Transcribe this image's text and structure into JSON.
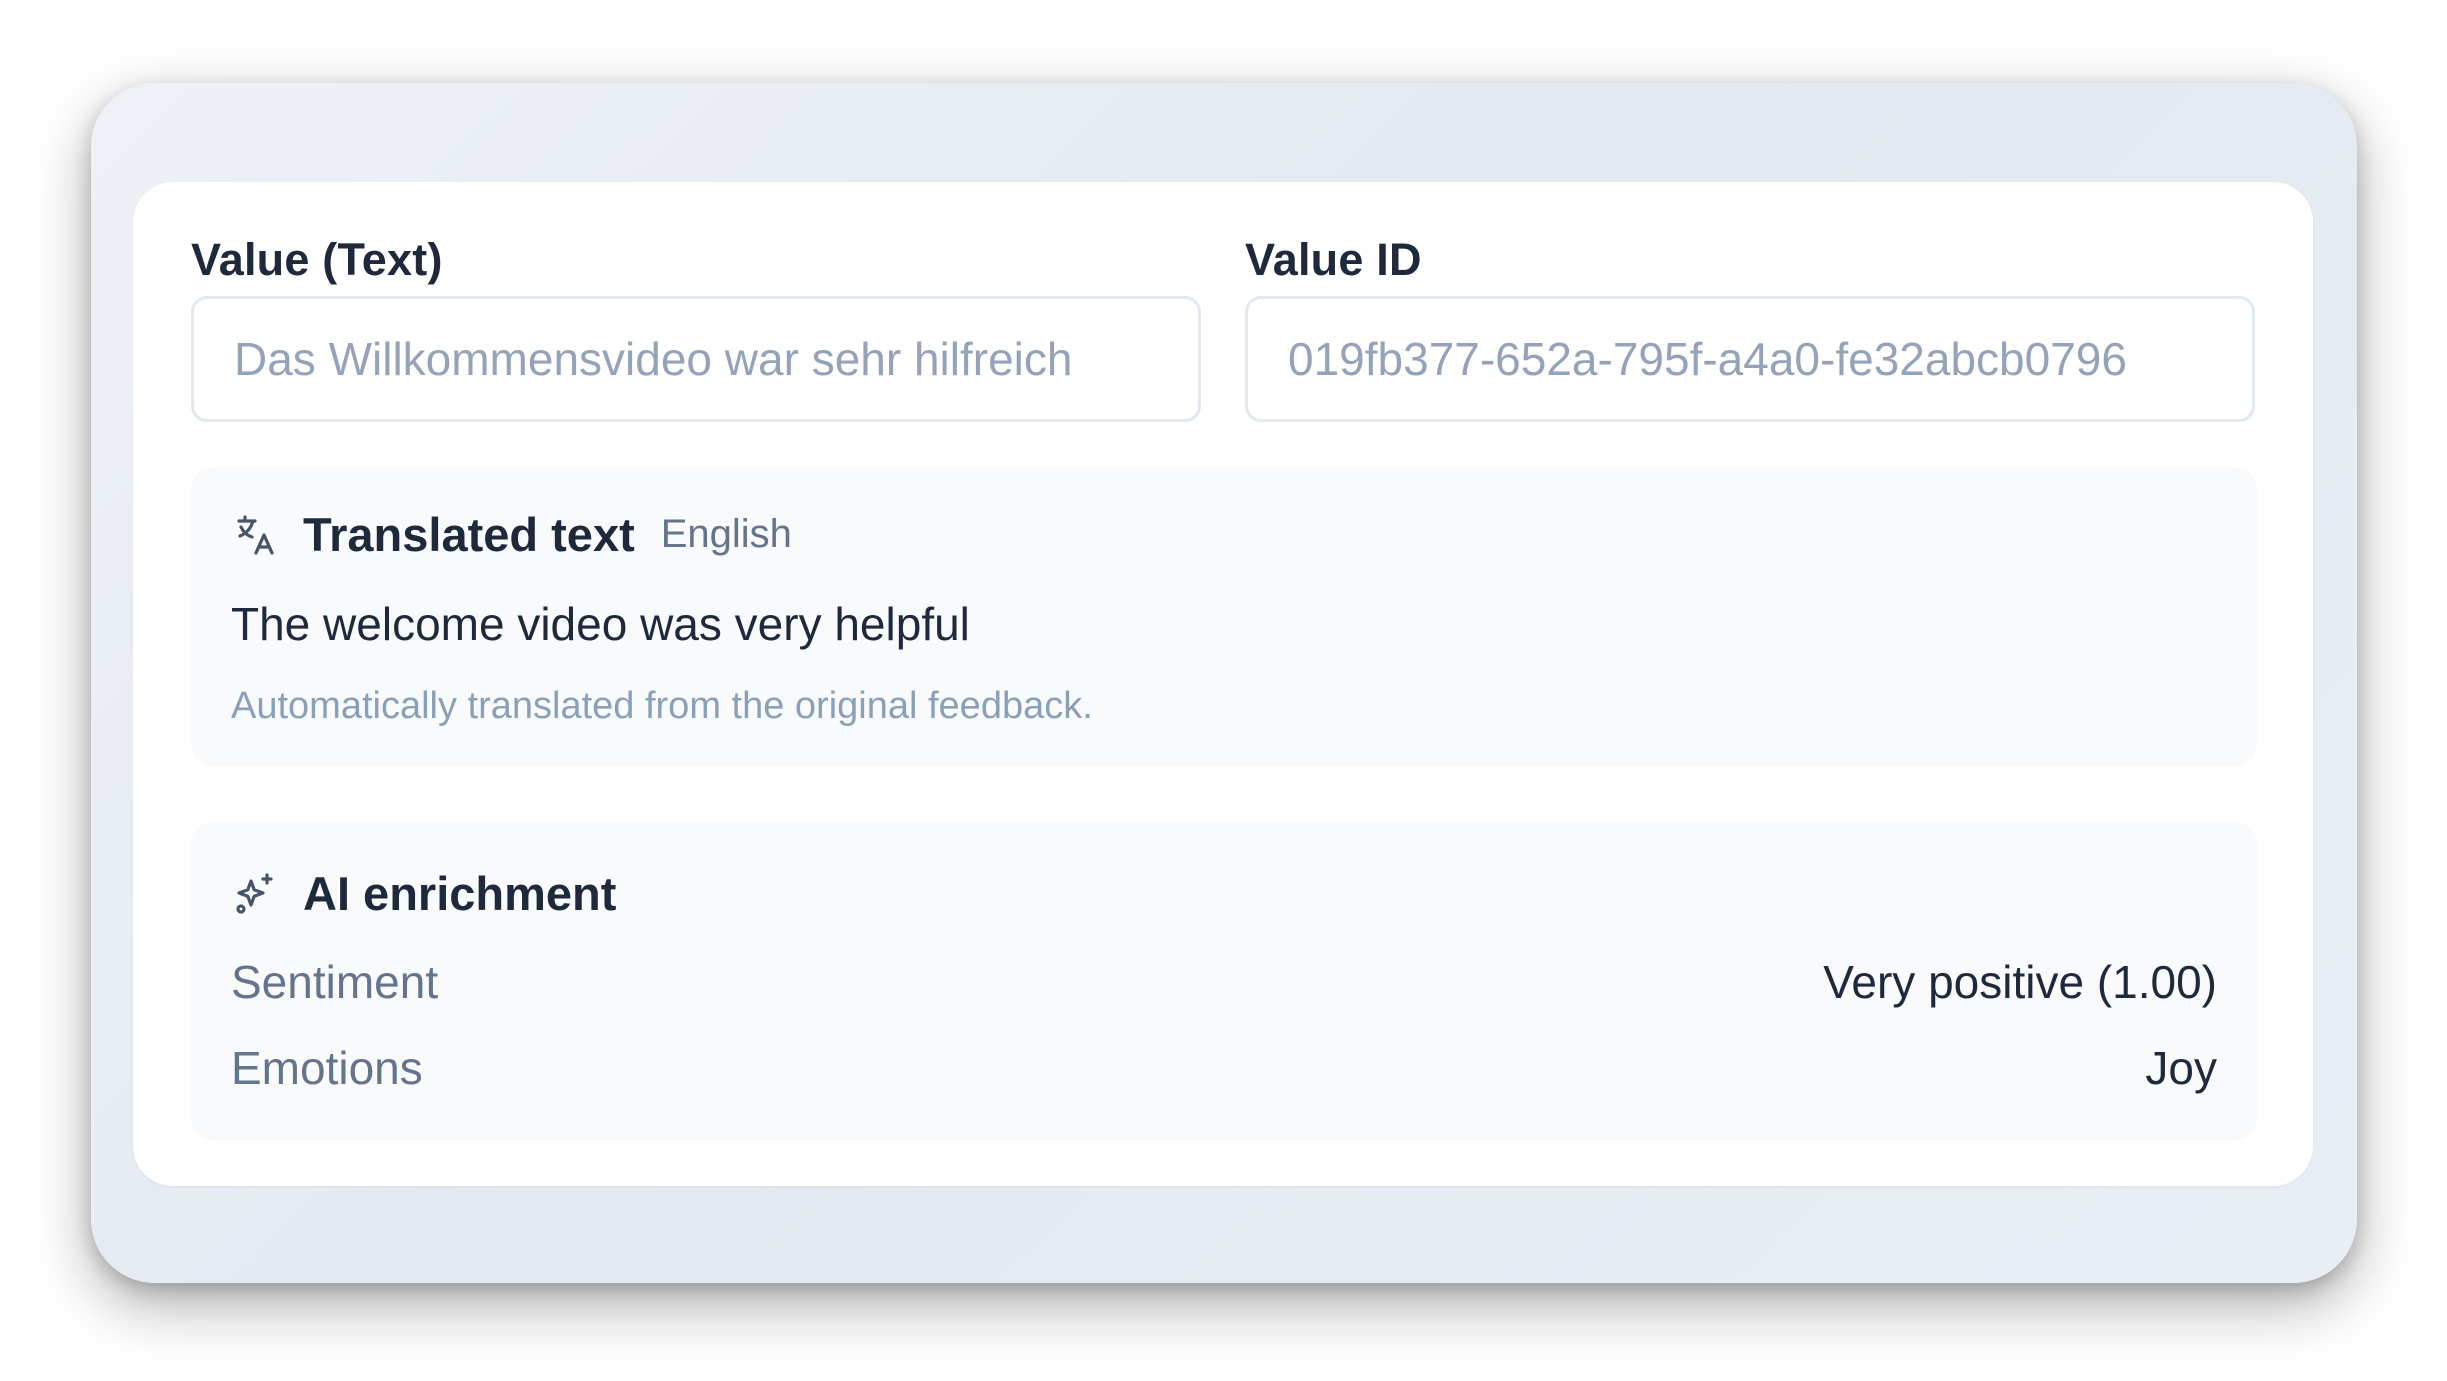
{
  "fields": {
    "value_text": {
      "label": "Value (Text)",
      "placeholder": "Das Willkommensvideo war sehr hilfreich"
    },
    "value_id": {
      "label": "Value ID",
      "placeholder": "019fb377-652a-795f-a4a0-fe32abcb0796"
    }
  },
  "translation": {
    "icon": "translate-icon",
    "title": "Translated text",
    "language": "English",
    "text": "The welcome video was very helpful",
    "note": "Automatically translated from the original feedback."
  },
  "enrichment": {
    "icon": "sparkles-icon",
    "title": "AI enrichment",
    "rows": [
      {
        "key": "Sentiment",
        "value": "Very positive (1.00)"
      },
      {
        "key": "Emotions",
        "value": "Joy"
      }
    ]
  },
  "colors": {
    "text_primary": "#1e293b",
    "text_muted": "#64748b",
    "text_faint": "#8aa0b8",
    "panel_bg": "#f8fafc",
    "border": "#e2e8f0"
  }
}
